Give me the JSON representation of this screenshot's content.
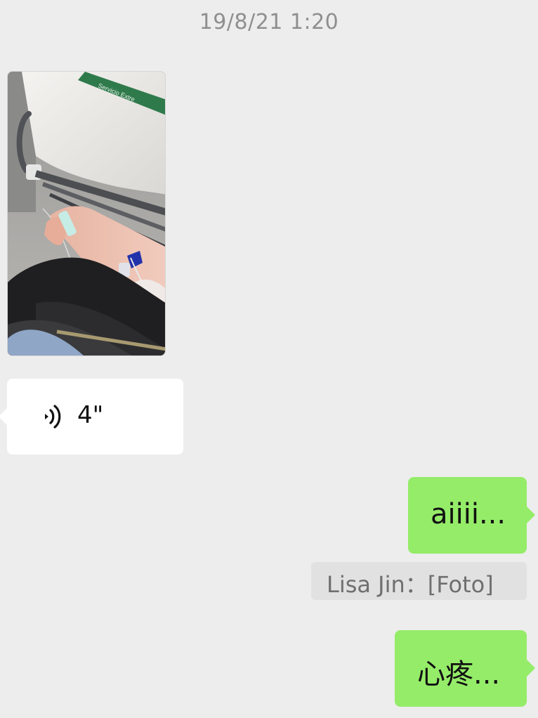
{
  "timestamp": "19/8/21 1:20",
  "messages": {
    "photo": {
      "type": "image",
      "direction": "incoming",
      "visible_text": "Servicio Extre"
    },
    "voice": {
      "type": "voice",
      "direction": "incoming",
      "duration": "4\"",
      "icon": "voice-wave-icon"
    },
    "reply_aiiii": {
      "type": "text",
      "direction": "outgoing",
      "text": "aiiii..."
    },
    "quote": {
      "text": "Lisa Jin：[Foto]"
    },
    "reply_xinteng": {
      "type": "text",
      "direction": "outgoing",
      "text": "心疼..."
    }
  },
  "colors": {
    "background": "#ededed",
    "outgoing_bubble": "#95ec69",
    "incoming_bubble": "#ffffff",
    "quote_bg": "#e1e1e1",
    "timestamp": "#8f8f8f"
  }
}
